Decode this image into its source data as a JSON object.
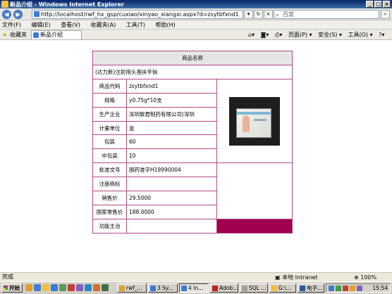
{
  "window": {
    "title": "新品介绍 - Windows Internet Explorer",
    "minimize": "_",
    "maximize": "□",
    "close": "×"
  },
  "address": {
    "url": "http://localhost/rwf_hx_gsp/cuxiao/xinyao_xiangxi.aspx?d=zsytbfxnd1",
    "search_placeholder": "百度",
    "back": "◀",
    "forward": "▶"
  },
  "menu": [
    "文件(F)",
    "编辑(E)",
    "查看(V)",
    "收藏夹(A)",
    "工具(T)",
    "帮助(H)"
  ],
  "favorites": {
    "label": "收藏夹",
    "tab_title": "新品介绍",
    "tools": [
      "页面(P) ▾",
      "安全(S) ▾",
      "工具(O) ▾"
    ]
  },
  "product": {
    "header": "商品名称",
    "name": "(达力新)注射用头孢呋辛钠",
    "fields": [
      {
        "label": "商品代码",
        "value": "zsytbfxnd1"
      },
      {
        "label": "规格",
        "value": "y0.75g*10支"
      },
      {
        "label": "生产企业",
        "value": "深圳致君制药有限公司(深圳"
      },
      {
        "label": "计量单位",
        "value": "盒"
      },
      {
        "label": "包装",
        "value": "60"
      },
      {
        "label": "中包装",
        "value": "10"
      },
      {
        "label": "批准文号",
        "value": "国药准字H19990004"
      },
      {
        "label": "注册商标",
        "value": ""
      },
      {
        "label": "销售价",
        "value": "29.5000"
      },
      {
        "label": "国家零售价",
        "value": "188.0000"
      },
      {
        "label": "功能主治",
        "value": ""
      }
    ]
  },
  "status": {
    "left": "完成",
    "zone": "本地 Intranet",
    "zoom": "100%"
  },
  "taskbar": {
    "start": "开始",
    "tasks": [
      "rwf_...",
      "3 Sy...",
      "4 In...",
      "Adob...",
      "SQL ...",
      "G:\\...",
      "电子..."
    ],
    "clock": "15:54"
  },
  "colors": {
    "table_border": "#b04a8a",
    "accent_cell": "#a0004f",
    "title_bar": "#0a246a"
  }
}
